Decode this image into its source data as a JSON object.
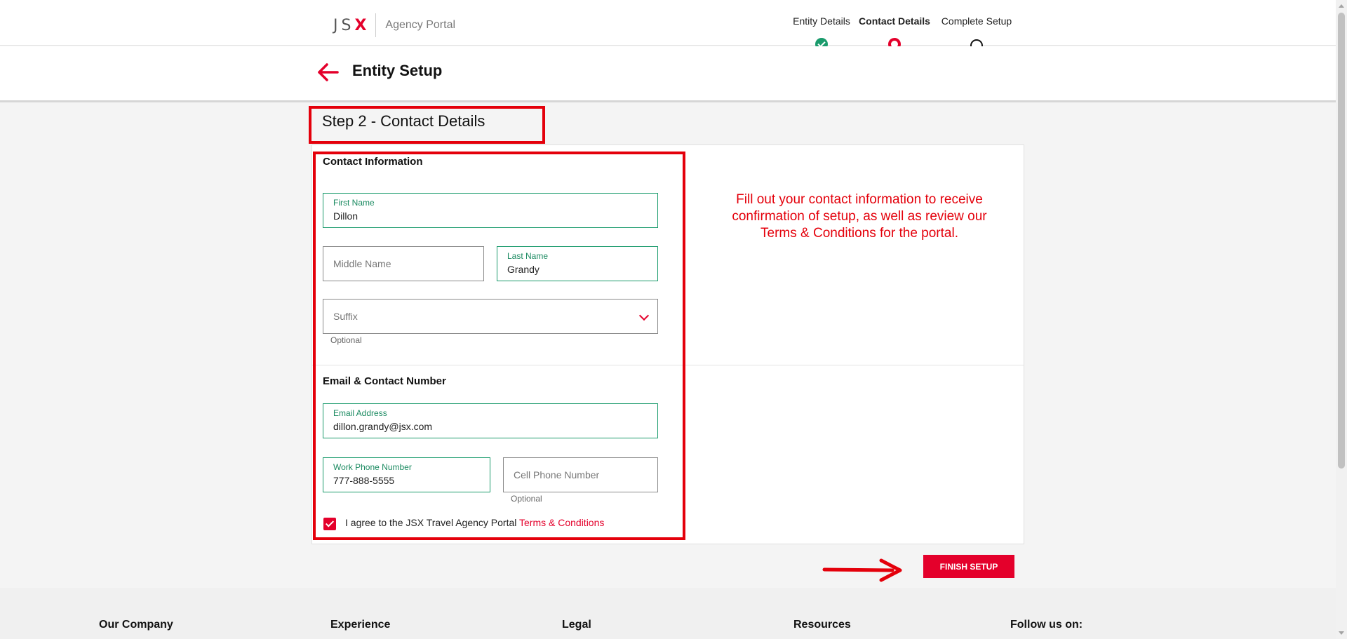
{
  "header": {
    "logo_text": "JS",
    "logo_x": "X",
    "portal_label": "Agency Portal"
  },
  "stepper": {
    "steps": [
      {
        "label": "Entity Details",
        "state": "done"
      },
      {
        "label": "Contact Details",
        "state": "current"
      },
      {
        "label": "Complete Setup",
        "state": "todo"
      }
    ]
  },
  "page": {
    "title": "Entity Setup",
    "step_title": "Step 2 - Contact Details"
  },
  "contact": {
    "heading": "Contact Information",
    "first_name": {
      "label": "First Name",
      "value": "Dillon"
    },
    "middle_name": {
      "placeholder": "Middle Name"
    },
    "last_name": {
      "label": "Last Name",
      "value": "Grandy"
    },
    "suffix": {
      "placeholder": "Suffix",
      "hint": "Optional"
    }
  },
  "email_contact": {
    "heading": "Email & Contact Number",
    "email": {
      "label": "Email Address",
      "value": "dillon.grandy@jsx.com"
    },
    "work_phone": {
      "label": "Work Phone Number",
      "value": "777-888-5555"
    },
    "cell_phone": {
      "placeholder": "Cell Phone Number",
      "hint": "Optional"
    }
  },
  "agreement": {
    "checked": true,
    "text": "I agree to the JSX Travel Agency Portal ",
    "link": "Terms & Conditions"
  },
  "annotation": "Fill out your contact information to receive confirmation of setup, as well as review our Terms & Conditions for the portal.",
  "actions": {
    "finish_label": "FINISH SETUP"
  },
  "footer": {
    "columns": [
      "Our Company",
      "Experience",
      "Legal",
      "Resources",
      "Follow us on:"
    ]
  },
  "colors": {
    "brand_red": "#e4002b",
    "success_green": "#1a9b6c",
    "annotation_red": "#e4000b"
  },
  "icons": {
    "back": "arrow-left-icon",
    "done": "check-circle-icon",
    "dropdown": "chevron-down-icon"
  }
}
